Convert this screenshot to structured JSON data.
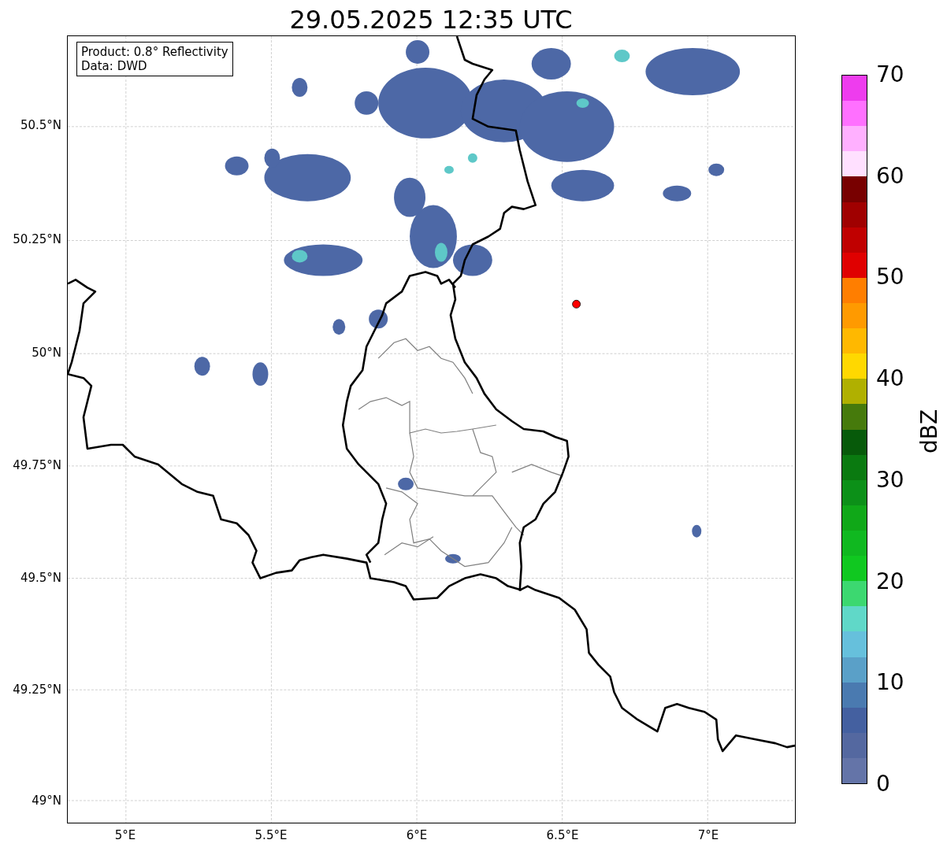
{
  "title": "29.05.2025 12:35 UTC",
  "info_box": {
    "lines": [
      "Product: 0.8° Reflectivity",
      "Data: DWD"
    ]
  },
  "map": {
    "x_ticks": [
      "5°E",
      "5.5°E",
      "6°E",
      "6.5°E",
      "7°E"
    ],
    "y_ticks": [
      "50.5°N",
      "50.25°N",
      "50°N",
      "49.75°N",
      "49.5°N",
      "49.25°N",
      "49°N"
    ]
  },
  "colorbar": {
    "label": "dBZ",
    "ticks": [
      "70",
      "60",
      "50",
      "40",
      "30",
      "20",
      "10",
      "0"
    ],
    "segments": [
      {
        "color": "#ee3cee"
      },
      {
        "color": "#ff70ff"
      },
      {
        "color": "#ffb0ff"
      },
      {
        "color": "#ffe0ff"
      },
      {
        "color": "#780000"
      },
      {
        "color": "#a00000"
      },
      {
        "color": "#c00000"
      },
      {
        "color": "#e00000"
      },
      {
        "color": "#ff7e00"
      },
      {
        "color": "#ff9a00"
      },
      {
        "color": "#ffb800"
      },
      {
        "color": "#ffd800"
      },
      {
        "color": "#b0b000"
      },
      {
        "color": "#467a0c"
      },
      {
        "color": "#075a0a"
      },
      {
        "color": "#0a7a10"
      },
      {
        "color": "#0c9018"
      },
      {
        "color": "#10a818"
      },
      {
        "color": "#10b820"
      },
      {
        "color": "#10c820"
      },
      {
        "color": "#3cd870"
      },
      {
        "color": "#60d8c8"
      },
      {
        "color": "#66c0dc"
      },
      {
        "color": "#5aa0c8"
      },
      {
        "color": "#4a7ab0"
      },
      {
        "color": "#4460a0"
      },
      {
        "color": "#5468a0"
      },
      {
        "color": "#6474a8"
      }
    ]
  }
}
